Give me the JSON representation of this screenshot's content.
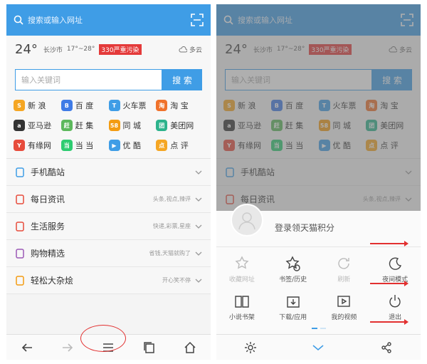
{
  "search": {
    "placeholder": "搜索或输入网址"
  },
  "weather": {
    "temp": "24°",
    "city": "长沙市",
    "range": "17°~28°",
    "pollution": "330严重污染",
    "condition": "多云"
  },
  "keyword": {
    "placeholder": "输入关键词",
    "button": "搜 索"
  },
  "sites": [
    {
      "label": "新 浪",
      "icon": "sina-icon",
      "color": "#f5a623",
      "glyph": "S"
    },
    {
      "label": "百 度",
      "icon": "baidu-icon",
      "color": "#3f7be6",
      "glyph": "B"
    },
    {
      "label": "火车票",
      "icon": "train-icon",
      "color": "#3f9de6",
      "glyph": "T"
    },
    {
      "label": "淘 宝",
      "icon": "taobao-icon",
      "color": "#f0722b",
      "glyph": "淘"
    },
    {
      "label": "亚马逊",
      "icon": "amazon-icon",
      "color": "#333333",
      "glyph": "a"
    },
    {
      "label": "赶 集",
      "icon": "ganji-icon",
      "color": "#5cb85c",
      "glyph": "赶"
    },
    {
      "label": "同 城",
      "icon": "tongcheng-icon",
      "color": "#f39c12",
      "glyph": "58"
    },
    {
      "label": "美团网",
      "icon": "meituan-icon",
      "color": "#2db38c",
      "glyph": "团"
    },
    {
      "label": "有缘网",
      "icon": "youyuan-icon",
      "color": "#e74c3c",
      "glyph": "Y"
    },
    {
      "label": "当 当",
      "icon": "dangdang-icon",
      "color": "#2ecc71",
      "glyph": "当"
    },
    {
      "label": "优 酷",
      "icon": "youku-icon",
      "color": "#3f9de6",
      "glyph": "▶"
    },
    {
      "label": "点 评",
      "icon": "dianping-icon",
      "color": "#f5a623",
      "glyph": "点"
    }
  ],
  "list": [
    {
      "label": "手机酷站",
      "sub": "",
      "icon": "phone-icon",
      "color": "#3f9de6"
    },
    {
      "label": "每日资讯",
      "sub": "头条,视点,辣评",
      "icon": "news-icon",
      "color": "#e74c3c"
    },
    {
      "label": "生活服务",
      "sub": "快递,彩票,星座",
      "icon": "search-service-icon",
      "color": "#e74c3c"
    },
    {
      "label": "购物精选",
      "sub": "省钱,天猫就购了",
      "icon": "shopping-icon",
      "color": "#9b59b6"
    },
    {
      "label": "轻松大杂烩",
      "sub": "开心笑不停",
      "icon": "smile-icon",
      "color": "#f39c12"
    }
  ],
  "overlay": {
    "login": "登录领天猫积分",
    "menu": [
      {
        "label": "收藏网址",
        "icon": "bookmark-add-icon",
        "disabled": true
      },
      {
        "label": "书签/历史",
        "icon": "bookmark-history-icon",
        "disabled": false
      },
      {
        "label": "刷新",
        "icon": "refresh-icon",
        "disabled": true
      },
      {
        "label": "夜间模式",
        "icon": "night-mode-icon",
        "disabled": false
      },
      {
        "label": "小说书架",
        "icon": "book-icon",
        "disabled": false
      },
      {
        "label": "下载/应用",
        "icon": "download-icon",
        "disabled": false
      },
      {
        "label": "我的视频",
        "icon": "video-icon",
        "disabled": false
      },
      {
        "label": "退出",
        "icon": "power-icon",
        "disabled": false
      }
    ]
  },
  "colors": {
    "accent": "#3f9de6",
    "annotation": "#e23030"
  }
}
